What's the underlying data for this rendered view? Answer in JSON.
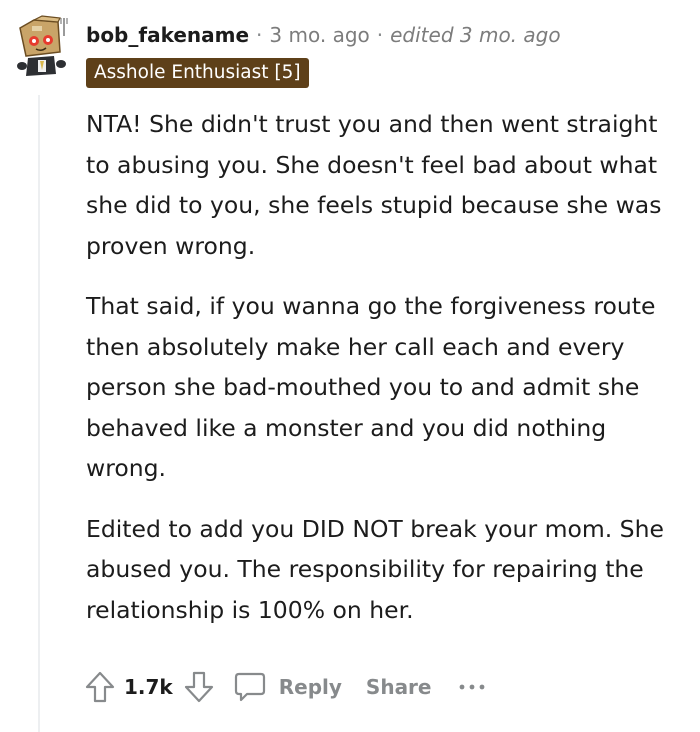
{
  "comment": {
    "username": "bob_fakename",
    "separator": "·",
    "age": "3 mo. ago",
    "edited": "edited 3 mo. ago",
    "flair": "Asshole Enthusiast [5]",
    "paragraphs": [
      "NTA! She didn't trust you and then went straight to abusing you. She doesn't feel bad about what she did to you, she feels stupid because she was proven wrong.",
      "That said, if you wanna go the forgiveness route then absolutely make her call each and every person she bad-mouthed you to and admit she behaved like a monster and you did nothing wrong.",
      "Edited to add you DID NOT break your mom. She abused you. The responsibility for repairing the relationship is 100% on her."
    ]
  },
  "actions": {
    "upvote_icon": "upvote-arrow-icon",
    "score": "1.7k",
    "downvote_icon": "downvote-arrow-icon",
    "reply_icon": "speech-bubble-icon",
    "reply_label": "Reply",
    "share_label": "Share",
    "more_icon": "ellipsis-icon"
  },
  "colors": {
    "text": "#1c1c1c",
    "meta": "#7c7c7c",
    "action_gray": "#878a8c",
    "flair_bg": "#5e4019",
    "flair_text": "#ffffff",
    "thread_line": "#edeff1"
  }
}
